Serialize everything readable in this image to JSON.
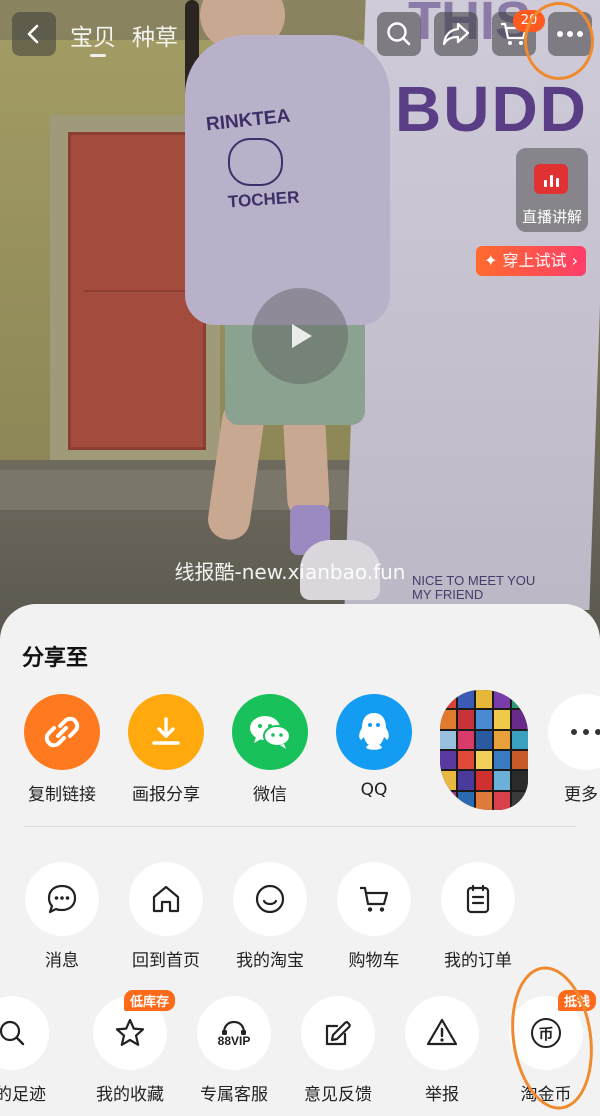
{
  "header": {
    "tabs": [
      "宝贝",
      "种草"
    ],
    "cart_count": "20",
    "live_label": "直播讲解",
    "try_on_label": "✦ 穿上试试 ›"
  },
  "photo": {
    "sweater_print_1": "RINKTEA",
    "sweater_print_2": "TOCHER",
    "sign_text": "BUDD",
    "sign_text_top": "THIS",
    "sign_small_1": "NICE TO MEET YOU",
    "sign_small_2": "MY FRIEND",
    "watermark": "线报酷-new.xianbao.fun"
  },
  "share_sheet": {
    "title": "分享至",
    "apps": [
      {
        "label": "复制链接",
        "icon": "link-icon",
        "color": "#ff7a1f"
      },
      {
        "label": "画报分享",
        "icon": "download-icon",
        "color": "#ffa90f"
      },
      {
        "label": "微信",
        "icon": "wechat-icon",
        "color": "#18c15a"
      },
      {
        "label": "QQ",
        "icon": "qq-icon",
        "color": "#139cf2"
      },
      {
        "label": "更多",
        "icon": "more-dots-icon",
        "color": "#ffffff"
      }
    ],
    "services_row1": [
      {
        "label": "消息",
        "icon": "chat-bubble-icon"
      },
      {
        "label": "回到首页",
        "icon": "home-icon"
      },
      {
        "label": "我的淘宝",
        "icon": "smile-icon"
      },
      {
        "label": "购物车",
        "icon": "cart-icon"
      },
      {
        "label": "我的订单",
        "icon": "clipboard-icon"
      }
    ],
    "services_row2": [
      {
        "label": "我的足迹",
        "icon": "footprint-search-icon"
      },
      {
        "label": "我的收藏",
        "icon": "star-icon",
        "badge": "低库存"
      },
      {
        "label": "专属客服",
        "icon": "headset-88vip-icon",
        "icon_text": "88VIP"
      },
      {
        "label": "意见反馈",
        "icon": "edit-icon"
      },
      {
        "label": "举报",
        "icon": "warning-icon"
      },
      {
        "label": "淘金币",
        "icon": "coin-icon",
        "badge": "抵钱",
        "icon_text": "币"
      }
    ]
  },
  "colors": {
    "accent_orange": "#ff6a1a",
    "sheet_bg": "#f2f2f2",
    "annotation": "#f08a2e"
  }
}
